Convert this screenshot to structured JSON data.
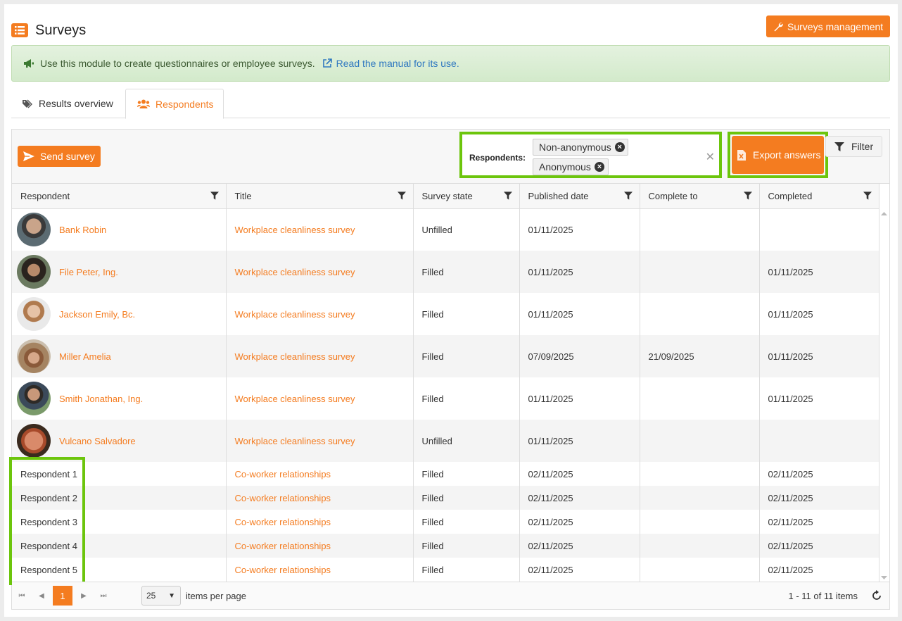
{
  "page": {
    "title": "Surveys",
    "management_button": "Surveys management"
  },
  "info": {
    "text": "Use this module to create questionnaires or employee surveys.",
    "link": "Read the manual for its use."
  },
  "tabs": [
    {
      "label": "Results overview"
    },
    {
      "label": "Respondents"
    }
  ],
  "toolbar": {
    "send_label": "Send survey",
    "respondents_label": "Respondents:",
    "chips": [
      "Non-anonymous",
      "Anonymous"
    ],
    "export_label": "Export answers",
    "filter_label": "Filter"
  },
  "columns": [
    "Respondent",
    "Title",
    "Survey state",
    "Published date",
    "Complete to",
    "Completed"
  ],
  "rows": [
    {
      "respondent": "Bank Robin",
      "title": "Workplace cleanliness survey",
      "state": "Unfilled",
      "published": "01/11/2025",
      "complete_to": "",
      "completed": ""
    },
    {
      "respondent": "File Peter, Ing.",
      "title": "Workplace cleanliness survey",
      "state": "Filled",
      "published": "01/11/2025",
      "complete_to": "",
      "completed": "01/11/2025"
    },
    {
      "respondent": "Jackson Emily, Bc.",
      "title": "Workplace cleanliness survey",
      "state": "Filled",
      "published": "01/11/2025",
      "complete_to": "",
      "completed": "01/11/2025"
    },
    {
      "respondent": "Miller Amelia",
      "title": "Workplace cleanliness survey",
      "state": "Filled",
      "published": "07/09/2025",
      "complete_to": "21/09/2025",
      "completed": "01/11/2025"
    },
    {
      "respondent": "Smith Jonathan, Ing.",
      "title": "Workplace cleanliness survey",
      "state": "Filled",
      "published": "01/11/2025",
      "complete_to": "",
      "completed": "01/11/2025"
    },
    {
      "respondent": "Vulcano Salvadore",
      "title": "Workplace cleanliness survey",
      "state": "Unfilled",
      "published": "01/11/2025",
      "complete_to": "",
      "completed": ""
    },
    {
      "respondent": "Respondent 1",
      "title": "Co-worker relationships",
      "state": "Filled",
      "published": "02/11/2025",
      "complete_to": "",
      "completed": "02/11/2025"
    },
    {
      "respondent": "Respondent 2",
      "title": "Co-worker relationships",
      "state": "Filled",
      "published": "02/11/2025",
      "complete_to": "",
      "completed": "02/11/2025"
    },
    {
      "respondent": "Respondent 3",
      "title": "Co-worker relationships",
      "state": "Filled",
      "published": "02/11/2025",
      "complete_to": "",
      "completed": "02/11/2025"
    },
    {
      "respondent": "Respondent 4",
      "title": "Co-worker relationships",
      "state": "Filled",
      "published": "02/11/2025",
      "complete_to": "",
      "completed": "02/11/2025"
    },
    {
      "respondent": "Respondent 5",
      "title": "Co-worker relationships",
      "state": "Filled",
      "published": "02/11/2025",
      "complete_to": "",
      "completed": "02/11/2025"
    }
  ],
  "pager": {
    "current": "1",
    "page_size": "25",
    "items_per_page": "items per page",
    "info": "1 - 11 of 11 items"
  },
  "colors": {
    "accent": "#f47c20",
    "highlight": "#6cc50c",
    "link": "#2f78c0"
  }
}
